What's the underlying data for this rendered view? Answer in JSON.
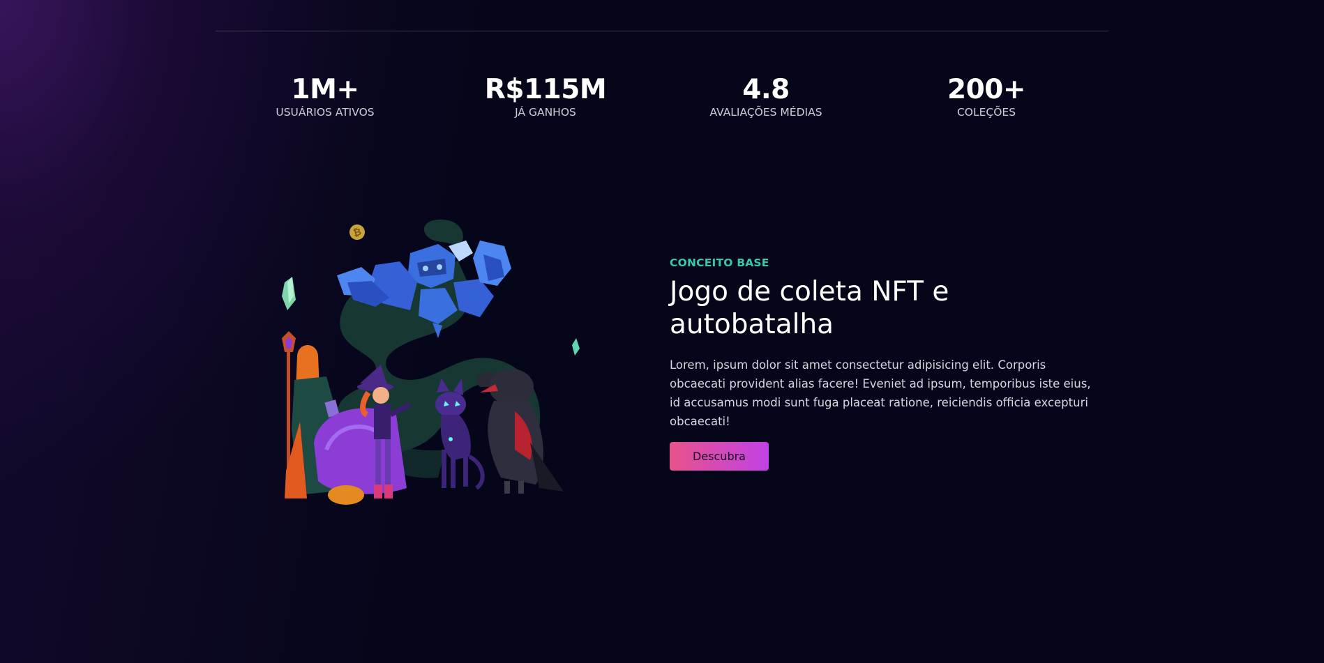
{
  "stats": [
    {
      "value": "1M+",
      "label": "USUÁRIOS ATIVOS"
    },
    {
      "value": "R$115M",
      "label": "JÁ GANHOS"
    },
    {
      "value": "4.8",
      "label": "AVALIAÇÕES MÉDIAS"
    },
    {
      "value": "200+",
      "label": "COLEÇÕES"
    }
  ],
  "feature": {
    "eyebrow": "CONCEITO BASE",
    "title": "Jogo de coleta NFT e autobatalha",
    "body": "Lorem, ipsum dolor sit amet consectetur adipisicing elit. Corporis obcaecati provident alias facere! Eveniet ad ipsum, temporibus iste eius, id accusamus modi sunt fuga placeat ratione, reiciendis officia excepturi obcaecati!",
    "button_label": "Descubra"
  },
  "colors": {
    "background": "#06061a",
    "accent_teal": "#36c9a8",
    "button_gradient_start": "#e8528a",
    "button_gradient_end": "#c042e6"
  },
  "icons": {
    "illustration": "fantasy-characters-illustration",
    "coin": "bitcoin-coin-icon",
    "crystal": "crystal-icon"
  }
}
